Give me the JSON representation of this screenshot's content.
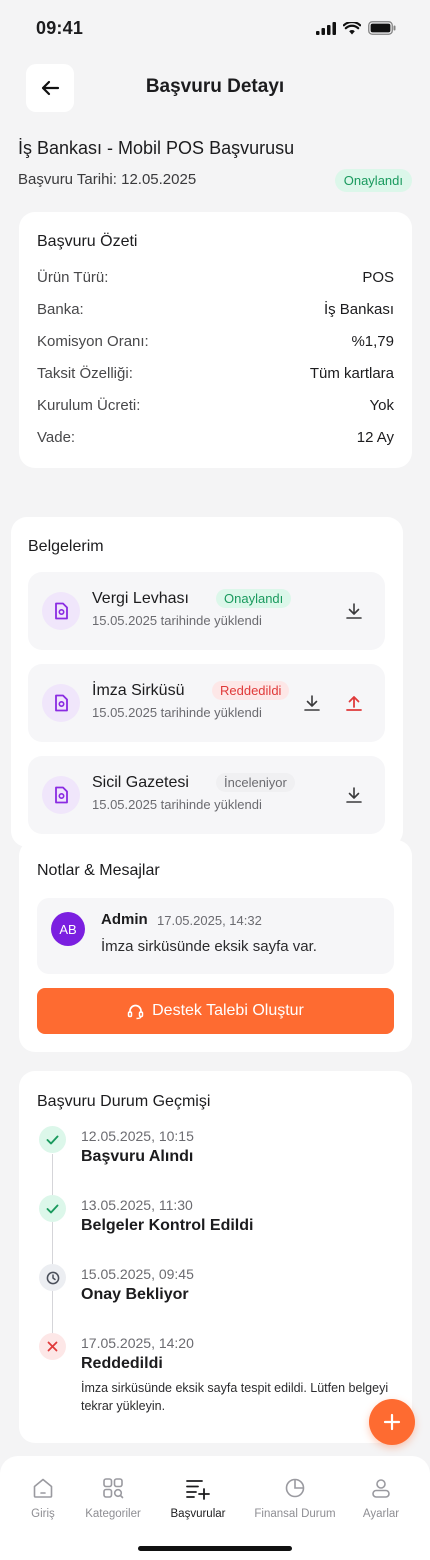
{
  "status_bar": {
    "time": "09:41"
  },
  "header": {
    "title": "Başvuru Detayı"
  },
  "application": {
    "title": "İş Bankası - Mobil POS Başvurusu",
    "date_label": "Başvuru Tarihi: 12.05.2025",
    "status": "Onaylandı"
  },
  "summary": {
    "title": "Başvuru Özeti",
    "rows": [
      {
        "label": "Ürün Türü:",
        "value": "POS"
      },
      {
        "label": "Banka:",
        "value": "İş Bankası"
      },
      {
        "label": "Komisyon Oranı:",
        "value": "%1,79"
      },
      {
        "label": "Taksit Özelliği:",
        "value": "Tüm kartlara"
      },
      {
        "label": "Kurulum Ücreti:",
        "value": "Yok"
      },
      {
        "label": "Vade:",
        "value": "12 Ay"
      }
    ]
  },
  "documents": {
    "title": "Belgelerim",
    "items": [
      {
        "name": "Vergi Levhası",
        "status": "Onaylandı",
        "subtitle": "15.05.2025 tarihinde yüklendi"
      },
      {
        "name": "İmza Sirküsü",
        "status": "Reddedildi",
        "subtitle": "15.05.2025 tarihinde yüklendi"
      },
      {
        "name": "Sicil Gazetesi",
        "status": "İnceleniyor",
        "subtitle": "15.05.2025 tarihinde yüklendi"
      }
    ]
  },
  "notes": {
    "title": "Notlar & Mesajlar",
    "message": {
      "avatar_initials": "AB",
      "author": "Admin",
      "time": "17.05.2025, 14:32",
      "text": "İmza sirküsünde eksik sayfa var."
    },
    "support_button": "Destek Talebi Oluştur"
  },
  "history": {
    "title": "Başvuru Durum Geçmişi",
    "events": [
      {
        "date": "12.05.2025, 10:15",
        "title": "Başvuru Alındı",
        "state": "done"
      },
      {
        "date": "13.05.2025, 11:30",
        "title": "Belgeler Kontrol Edildi",
        "state": "done"
      },
      {
        "date": "15.05.2025, 09:45",
        "title": "Onay Bekliyor",
        "state": "pending"
      },
      {
        "date": "17.05.2025, 14:20",
        "title": "Reddedildi",
        "state": "rejected",
        "note": "İmza sirküsünde eksik sayfa tespit edildi. Lütfen belgeyi tekrar yükleyin."
      }
    ]
  },
  "nav": {
    "items": [
      {
        "label": "Giriş",
        "icon": "home-icon"
      },
      {
        "label": "Kategoriler",
        "icon": "categories-icon"
      },
      {
        "label": "Başvurular",
        "icon": "applications-icon",
        "active": true
      },
      {
        "label": "Finansal Durum",
        "icon": "pie-chart-icon"
      },
      {
        "label": "Ayarlar",
        "icon": "user-icon"
      }
    ]
  },
  "colors": {
    "accent": "#fe6b31",
    "approved_bg": "#dcf7ea",
    "approved_fg": "#1a9a5e",
    "rejected_bg": "#fde7e7",
    "rejected_fg": "#e03a3a",
    "reviewing_bg": "#f0f0f2",
    "reviewing_fg": "#6b6b70",
    "doc_icon": "#8a2be2"
  }
}
